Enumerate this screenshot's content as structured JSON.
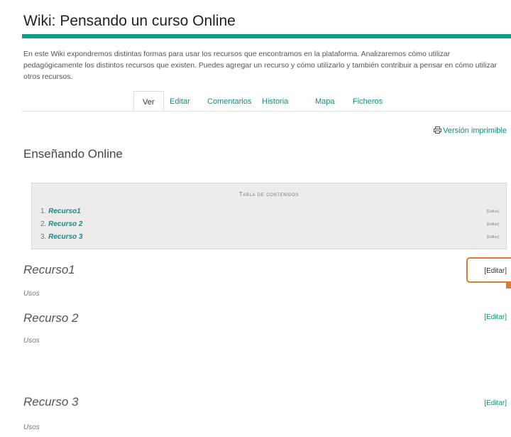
{
  "wiki": {
    "title": "Wiki: Pensando un curso Online",
    "description": "En este Wiki expondremos distintas formas para usar los recursos que encontramos en la plataforma. Analizaremos cómo utilizar pedagógicamente los distintos recursos que existen. Puedes agregar un recurso y cómo utilizarlo y también contribuir a pensar en cómo utilizar otros recursos."
  },
  "tabs": [
    {
      "label": "Ver",
      "active": true
    },
    {
      "label": "Editar",
      "active": false
    },
    {
      "label": "Comentarios",
      "active": false
    },
    {
      "label": "Historia",
      "active": false
    },
    {
      "label": "Mapa",
      "active": false
    },
    {
      "label": "Ficheros",
      "active": false
    }
  ],
  "print_link": {
    "icon": "printer-icon",
    "label": "Versión imprimible"
  },
  "page": {
    "heading": "Enseñando Online"
  },
  "toc": {
    "title": "Tabla de contenidos",
    "items": [
      {
        "number": "1.",
        "label": "Recurso1",
        "edit": "[Editar]"
      },
      {
        "number": "2.",
        "label": "Recurso 2",
        "edit": "[Editar]"
      },
      {
        "number": "3.",
        "label": "Recurso 3",
        "edit": "[Editar]"
      }
    ]
  },
  "sections": [
    {
      "heading": "Recurso1",
      "body": "Usos",
      "edit": "[Editar]",
      "highlighted": true
    },
    {
      "heading": "Recurso 2",
      "body": "Usos",
      "edit": "[Editar]",
      "highlighted": false
    },
    {
      "heading": "Recurso 3",
      "body": "Usos",
      "edit": "[Editar]",
      "highlighted": false
    }
  ],
  "colors": {
    "accent": "#0f9e82",
    "link": "#0f8f7a",
    "highlight": "#e07b34"
  }
}
